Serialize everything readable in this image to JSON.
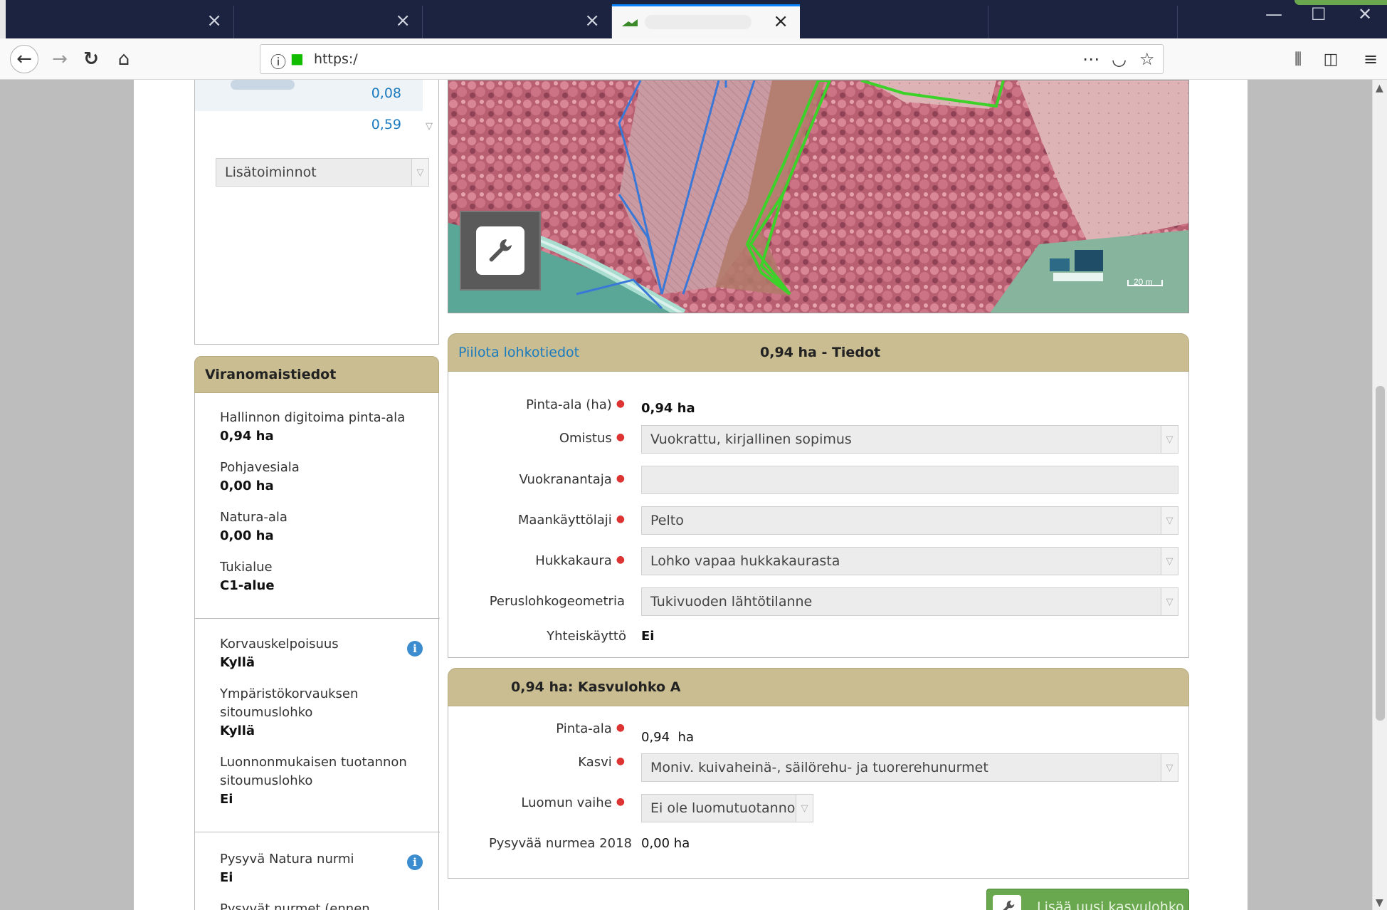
{
  "browser": {
    "tabs": [
      {
        "close": "×"
      },
      {
        "close": "×"
      },
      {
        "close": "×"
      },
      {
        "close": "×",
        "active": true
      },
      {
        "close": ""
      },
      {
        "close": ""
      }
    ],
    "window_controls": {
      "minimize": "—",
      "maximize": "☐",
      "close": "✕"
    },
    "url": "https:/",
    "toolbar_icons": [
      "back-icon",
      "forward-icon",
      "reload-icon",
      "home-icon",
      "info-icon",
      "lock-icon",
      "more-icon",
      "pocket-icon",
      "bookmark-star-icon",
      "library-icon",
      "sidebar-icon",
      "menu-icon"
    ]
  },
  "left": {
    "list_values": [
      "0,08",
      "0,59"
    ],
    "actions_select": "Lisätoiminnot"
  },
  "authority": {
    "title": "Viranomaistiedot",
    "section1": [
      {
        "label": "Hallinnon digitoima pinta-ala",
        "value": "0,94 ha"
      },
      {
        "label": "Pohjavesiala",
        "value": "0,00 ha"
      },
      {
        "label": "Natura-ala",
        "value": "0,00 ha"
      },
      {
        "label": "Tukialue",
        "value": "C1-alue"
      }
    ],
    "section2": [
      {
        "label": "Korvauskelpoisuus",
        "value": "Kyllä",
        "info": true
      },
      {
        "label": "Ympäristökorvauksen sitoumuslohko",
        "value": "Kyllä"
      },
      {
        "label": "Luonnonmukaisen tuotannon sitoumuslohko",
        "value": "Ei"
      }
    ],
    "section3": [
      {
        "label": "Pysyvä Natura nurmi",
        "value": "Ei",
        "info": true
      },
      {
        "label": "Pysyvät nurmet (ennen",
        "value": ""
      }
    ]
  },
  "map": {
    "scale": "20 m",
    "colors": {
      "vegetation": "#c46a7e",
      "field_blue": "#3a78d8",
      "field_green": "#3cd22a",
      "road": "#9fd6c8"
    }
  },
  "details": {
    "hide_link": "Piilota lohkotiedot",
    "title": "0,94 ha - Tiedot",
    "fields": {
      "area_label": "Pinta-ala (ha)",
      "area_value": "0,94 ha",
      "ownership_label": "Omistus",
      "ownership_value": "Vuokrattu, kirjallinen sopimus",
      "lessor_label": "Vuokranantaja",
      "lessor_value": "",
      "landuse_label": "Maankäyttölaji",
      "landuse_value": "Pelto",
      "oat_label": "Hukkakaura",
      "oat_value": "Lohko vapaa hukkakaurasta",
      "geometry_label": "Peruslohkogeometria",
      "geometry_value": "Tukivuoden lähtötilanne",
      "shared_label": "Yhteiskäyttö",
      "shared_value": "Ei"
    }
  },
  "crop": {
    "title": "0,94 ha: Kasvulohko A",
    "fields": {
      "area_label": "Pinta-ala",
      "area_value": "0,94",
      "area_unit": "ha",
      "crop_label": "Kasvi",
      "crop_value": "Moniv. kuivaheinä-, säilörehu- ja tuorerehunurmet",
      "organic_label": "Luomun vaihe",
      "organic_value": "Ei ole luomutuotannos",
      "grass_label": "Pysyvää nurmea 2018",
      "grass_value": "0,00 ha"
    },
    "add_button": "Lisää uusi kasvulohko"
  },
  "colors": {
    "panel_header": "#c9bd91",
    "link": "#1a7bbf",
    "button_green": "#6aa84f",
    "info_blue": "#3c8dcf"
  }
}
